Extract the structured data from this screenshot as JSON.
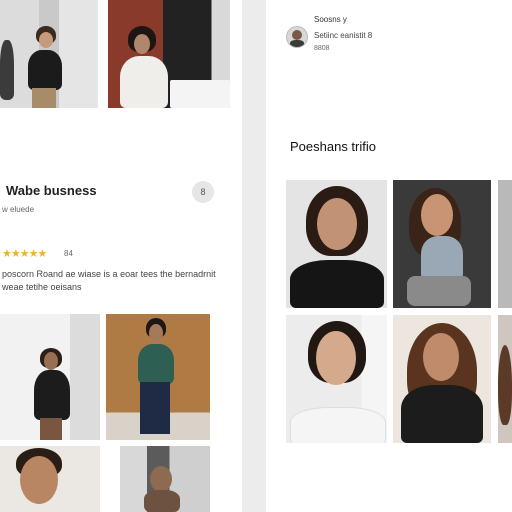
{
  "left": {
    "business_title": "Wabe busness",
    "business_subtitle": "w eluede",
    "more_button": "8",
    "rating_stars": "★★★★★",
    "rating_count": "84",
    "description_line1": "poscorn Roand ae wiase is a eoar tees the bernadrnit",
    "description_line2": "weae tetihe oeisans"
  },
  "right": {
    "profile_name": "Soosns y",
    "profile_subtitle": "Setiinc eanistit 8",
    "profile_meta": "8808",
    "section_title": "Poeshans trifio"
  },
  "colors": {
    "star": "#e8b339",
    "panel_bg": "#ffffff",
    "page_bg": "#ececec"
  }
}
